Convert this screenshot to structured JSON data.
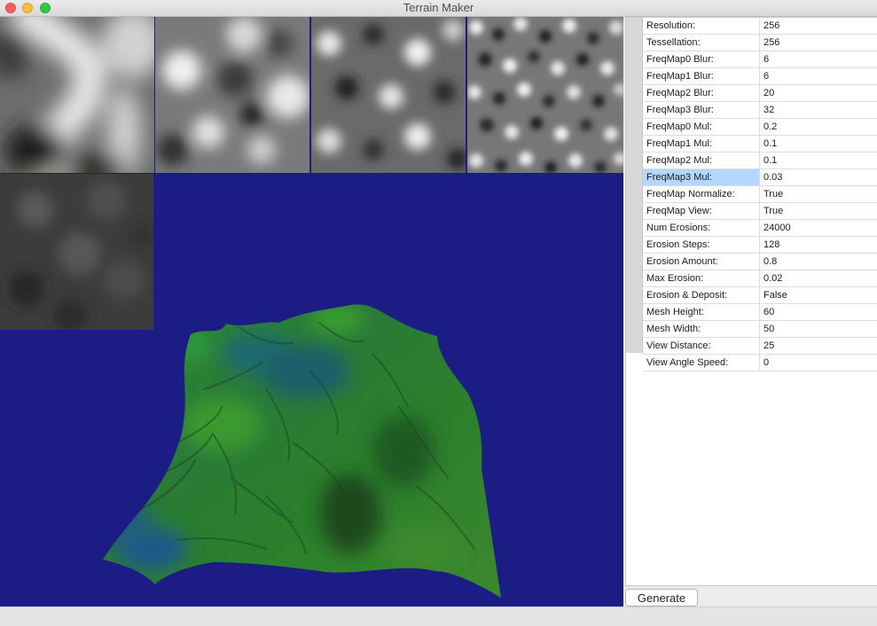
{
  "window": {
    "title": "Terrain Maker"
  },
  "colors": {
    "viewport_background": "#1c1c85",
    "mesh_green": "#2f8a2a",
    "mesh_blue": "#1f5a8c",
    "selection": "#b3d7ff"
  },
  "properties": [
    {
      "label": "Resolution:",
      "value": "256"
    },
    {
      "label": "Tessellation:",
      "value": "256"
    },
    {
      "label": "FreqMap0 Blur:",
      "value": "6"
    },
    {
      "label": "FreqMap1 Blur:",
      "value": "6"
    },
    {
      "label": "FreqMap2 Blur:",
      "value": "20"
    },
    {
      "label": "FreqMap3 Blur:",
      "value": "32"
    },
    {
      "label": "FreqMap0 Mul:",
      "value": "0.2"
    },
    {
      "label": "FreqMap1 Mul:",
      "value": "0.1"
    },
    {
      "label": "FreqMap2 Mul:",
      "value": "0.1"
    },
    {
      "label": "FreqMap3 Mul:",
      "value": "0.03",
      "selected": true
    },
    {
      "label": "FreqMap Normalize:",
      "value": "True"
    },
    {
      "label": "FreqMap View:",
      "value": "True"
    },
    {
      "label": "Num Erosions:",
      "value": "24000"
    },
    {
      "label": "Erosion Steps:",
      "value": "128"
    },
    {
      "label": "Erosion Amount:",
      "value": "0.8"
    },
    {
      "label": "Max Erosion:",
      "value": "0.02"
    },
    {
      "label": "Erosion & Deposit:",
      "value": "False"
    },
    {
      "label": "Mesh Height:",
      "value": "60"
    },
    {
      "label": "Mesh Width:",
      "value": "50"
    },
    {
      "label": "View Distance:",
      "value": "25"
    },
    {
      "label": "View Angle Speed:",
      "value": "0"
    }
  ],
  "generate_button": {
    "label": "Generate"
  }
}
